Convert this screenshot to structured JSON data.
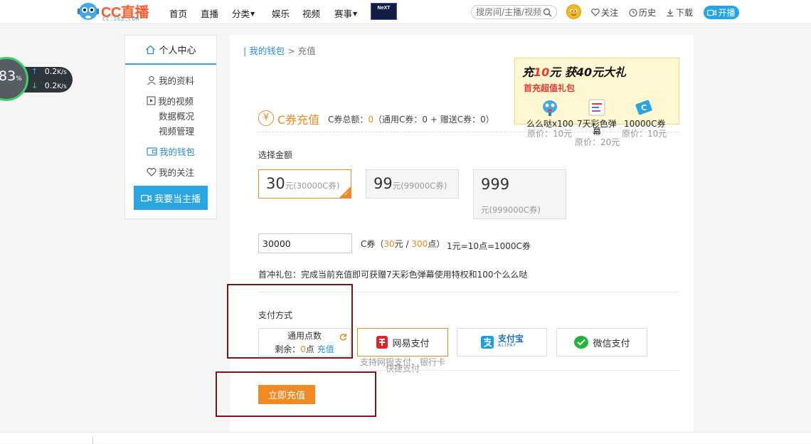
{
  "header": {
    "logo_text": "CC直播",
    "logo_sub": "CC.163.COM",
    "nav": [
      "首页",
      "直播",
      "分类",
      "娱乐",
      "视频",
      "赛事"
    ],
    "game_badge": "NeXT",
    "search_placeholder": "搜房间/主播/视频",
    "follow": "关注",
    "history": "历史",
    "download": "下载",
    "go_live": "开播"
  },
  "speed_widget": {
    "percent": "83",
    "percent_unit": "%",
    "upload": "0.2",
    "download": "0.2",
    "unit": "K/s"
  },
  "sidebar": {
    "title": "个人中心",
    "profile": "我的资料",
    "videos": "我的视频",
    "data_overview": "数据概况",
    "video_manage": "视频管理",
    "wallet": "我的钱包",
    "following": "我的关注",
    "be_anchor": "我要当主播"
  },
  "breadcrumb": {
    "parent": "我的钱包",
    "sep": ">",
    "current": "充值"
  },
  "recharge": {
    "coin_symbol": "¥",
    "title": "C券充值",
    "balance_prefix": "C券总额：",
    "balance_total": "0",
    "balance_mid": "（通用C券：0 + 赠送C券：0）",
    "choose_amount": "选择金额",
    "options": [
      {
        "amount": "30",
        "unit": "元",
        "detail": "(30000C券)"
      },
      {
        "amount": "99",
        "unit": "元",
        "detail": "(99000C券)"
      },
      {
        "amount": "999",
        "unit": "元",
        "detail": "(999000C券)"
      }
    ],
    "input_value": "30000",
    "conv_prefix": "C券（",
    "conv_yuan": "30",
    "conv_yuan_unit": "元 / ",
    "conv_points": "300",
    "conv_points_unit": "点）",
    "rate": "1元=10点=1000C券",
    "first_gift": "首冲礼包：完成当前充值即可获赠7天彩色弹幕使用特权和100个么么哒",
    "pay_method_label": "支付方式",
    "pay_points_title": "通用点数",
    "pay_points_balance_prefix": "剩余：",
    "pay_points_balance": "0",
    "pay_points_unit": "点",
    "pay_points_recharge": "充值",
    "pay_netease": "网易支付",
    "pay_alipay": "支付宝",
    "pay_alipay_sub": "ALIPAY",
    "pay_wechat": "微信支付",
    "pay_note_1": "支持网银支付、银行卡",
    "pay_note_2": "快捷支付",
    "submit": "立即充值"
  },
  "promo": {
    "headline_1": "充",
    "headline_num1": "10",
    "headline_2": "元 获",
    "headline_num2": "40",
    "headline_3": "元大礼",
    "subtitle": "首充超值礼包",
    "gift1": "么么哒x100",
    "gift1_price": "原价：10元",
    "gift2_line1": "7天彩色弹",
    "gift2_line2": "幕",
    "gift2_price": "原价：20元",
    "gift3": "10000C券",
    "gift3_price": "原价：10元"
  },
  "colors": {
    "accent_orange": "#f08a24",
    "brand_blue": "#29a6e1",
    "link_blue": "#2b8cd9",
    "annotation_box": "#7a1616"
  }
}
